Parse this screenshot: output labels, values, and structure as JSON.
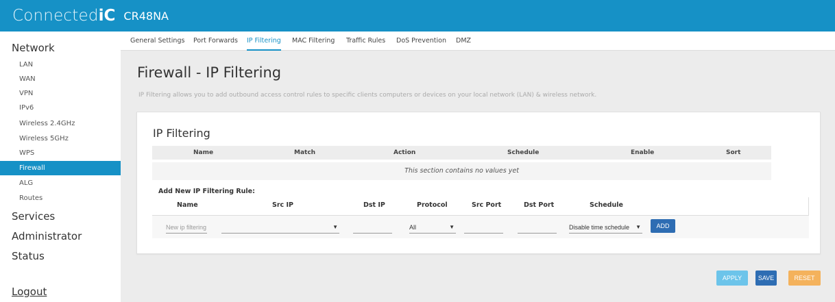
{
  "header": {
    "brand_light": "Connected",
    "brand_bold": "iC",
    "model": "CR48NA",
    "accent": "#1691c6"
  },
  "sidebar": {
    "network_label": "Network",
    "items": [
      {
        "label": "LAN"
      },
      {
        "label": "WAN"
      },
      {
        "label": "VPN"
      },
      {
        "label": "IPv6"
      },
      {
        "label": "Wireless 2.4GHz"
      },
      {
        "label": "Wireless 5GHz"
      },
      {
        "label": "WPS"
      },
      {
        "label": "Firewall",
        "active": true
      },
      {
        "label": "ALG"
      },
      {
        "label": "Routes"
      }
    ],
    "sections": [
      {
        "label": "Services"
      },
      {
        "label": "Administrator"
      },
      {
        "label": "Status"
      }
    ],
    "logout": "Logout"
  },
  "tabs": [
    {
      "label": "General Settings"
    },
    {
      "label": "Port Forwards"
    },
    {
      "label": "IP Filtering",
      "active": true
    },
    {
      "label": "MAC Filtering"
    },
    {
      "label": "Traffic Rules"
    },
    {
      "label": "DoS Prevention"
    },
    {
      "label": "DMZ"
    }
  ],
  "page": {
    "title": "Firewall - IP Filtering",
    "description": "IP Filtering allows you to add outbound access control rules to specific clients computers or devices on your local network (LAN) & wireless network."
  },
  "panel": {
    "title": "IP Filtering",
    "columns": [
      "Name",
      "Match",
      "Action",
      "Schedule",
      "Enable",
      "Sort"
    ],
    "empty_text": "This section contains no values yet"
  },
  "add_rule": {
    "label": "Add New IP Filtering Rule:",
    "columns": [
      "Name",
      "Src IP",
      "Dst IP",
      "Protocol",
      "Src Port",
      "Dst Port",
      "Schedule"
    ],
    "name_placeholder": "New ip filtering",
    "src_ip_value": "",
    "dst_ip_value": "",
    "protocol_value": "All",
    "src_port_value": "",
    "dst_port_value": "",
    "schedule_value": "Disable time schedule",
    "add_label": "ADD"
  },
  "actions": {
    "apply": "APPLY",
    "save": "SAVE",
    "reset": "RESET"
  }
}
